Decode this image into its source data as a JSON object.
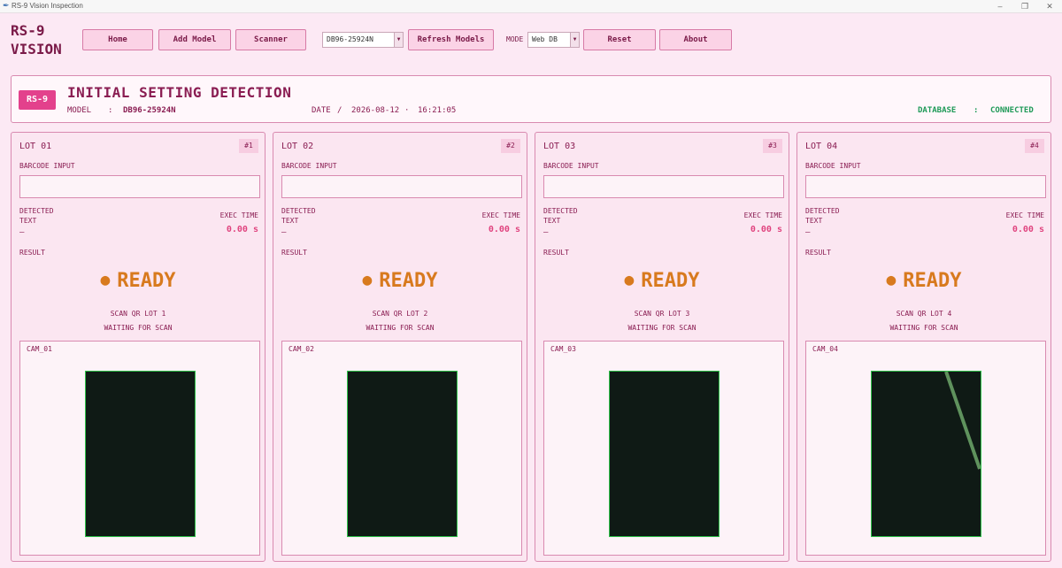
{
  "window": {
    "title": "RS-9 Vision Inspection"
  },
  "brand": {
    "line1": "RS-9",
    "line2": "VISION"
  },
  "toolbar": {
    "home": "Home",
    "add_model": "Add Model",
    "scanner": "Scanner",
    "model_select_value": "DB96-25924N",
    "refresh_models": "Refresh Models",
    "mode_label": "MODE",
    "mode_value": "Web DB",
    "reset": "Reset",
    "about": "About"
  },
  "header": {
    "badge": "RS-9",
    "title": "INITIAL SETTING DETECTION",
    "model_label": "MODEL",
    "model_sep": ":",
    "model_value": "DB96-25924N",
    "date_label": "DATE",
    "date_sep": "/",
    "date_value": "2026-08-12",
    "time_sep": "·",
    "time_value": "16:21:05",
    "db_label": "DATABASE",
    "db_sep": ":",
    "db_status": "CONNECTED"
  },
  "colors": {
    "background": "#fce9f4",
    "accent": "#e3418c",
    "ready": "#d87a1e",
    "connected": "#1f9a58",
    "cam_border": "#2fc24a"
  },
  "lots": [
    {
      "title": "LOT  01",
      "badge": "#1",
      "barcode_label": "BARCODE INPUT",
      "barcode_value": "",
      "detected_label_1": "DETECTED",
      "detected_label_2": "TEXT",
      "detected_value": "—",
      "exec_label": "EXEC TIME",
      "exec_value": "0.00 s",
      "result_label": "RESULT",
      "status": "READY",
      "scan_line": "SCAN QR LOT 1",
      "waiting": "WAITING FOR SCAN",
      "cam_label": "CAM_01"
    },
    {
      "title": "LOT  02",
      "badge": "#2",
      "barcode_label": "BARCODE INPUT",
      "barcode_value": "",
      "detected_label_1": "DETECTED",
      "detected_label_2": "TEXT",
      "detected_value": "—",
      "exec_label": "EXEC TIME",
      "exec_value": "0.00 s",
      "result_label": "RESULT",
      "status": "READY",
      "scan_line": "SCAN QR LOT 2",
      "waiting": "WAITING FOR SCAN",
      "cam_label": "CAM_02"
    },
    {
      "title": "LOT  03",
      "badge": "#3",
      "barcode_label": "BARCODE INPUT",
      "barcode_value": "",
      "detected_label_1": "DETECTED",
      "detected_label_2": "TEXT",
      "detected_value": "—",
      "exec_label": "EXEC TIME",
      "exec_value": "0.00 s",
      "result_label": "RESULT",
      "status": "READY",
      "scan_line": "SCAN QR LOT 3",
      "waiting": "WAITING FOR SCAN",
      "cam_label": "CAM_03"
    },
    {
      "title": "LOT  04",
      "badge": "#4",
      "barcode_label": "BARCODE INPUT",
      "barcode_value": "",
      "detected_label_1": "DETECTED",
      "detected_label_2": "TEXT",
      "detected_value": "—",
      "exec_label": "EXEC TIME",
      "exec_value": "0.00 s",
      "result_label": "RESULT",
      "status": "READY",
      "scan_line": "SCAN QR LOT 4",
      "waiting": "WAITING FOR SCAN",
      "cam_label": "CAM_04"
    }
  ]
}
